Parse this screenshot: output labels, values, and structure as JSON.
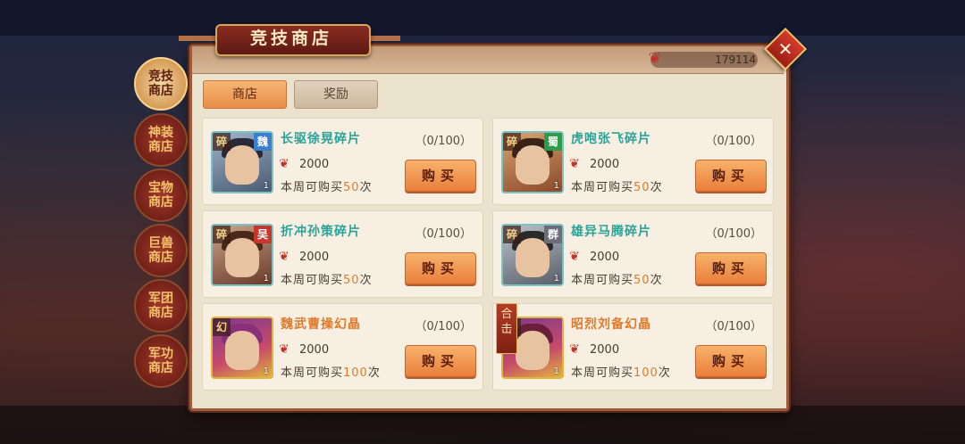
{
  "title": "竞技商店",
  "currency": {
    "icon": "coin-scroll-icon",
    "value": "179114"
  },
  "close_label": "✕",
  "tabs": [
    {
      "label": "商店",
      "active": true
    },
    {
      "label": "奖励",
      "active": false
    }
  ],
  "sidebar": [
    {
      "label": "竞技商店",
      "active": true
    },
    {
      "label": "神装商店",
      "active": false
    },
    {
      "label": "宝物商店",
      "active": false
    },
    {
      "label": "巨兽商店",
      "active": false
    },
    {
      "label": "军团商店",
      "active": false
    },
    {
      "label": "军功商店",
      "active": false
    }
  ],
  "items": [
    {
      "name": "长驱徐晃碎片",
      "limit": "（0/100）",
      "price": "2000",
      "weekly_prefix": "本周可购买",
      "weekly_num": "50",
      "weekly_suffix": "次",
      "buy_label": "购买",
      "tag": "碎",
      "faction": "魏",
      "count": "1",
      "kind": "fragment"
    },
    {
      "name": "虎咆张飞碎片",
      "limit": "（0/100）",
      "price": "2000",
      "weekly_prefix": "本周可购买",
      "weekly_num": "50",
      "weekly_suffix": "次",
      "buy_label": "购买",
      "tag": "碎",
      "faction": "蜀",
      "count": "1",
      "kind": "fragment"
    },
    {
      "name": "折冲孙策碎片",
      "limit": "（0/100）",
      "price": "2000",
      "weekly_prefix": "本周可购买",
      "weekly_num": "50",
      "weekly_suffix": "次",
      "buy_label": "购买",
      "tag": "碎",
      "faction": "吴",
      "count": "1",
      "kind": "fragment"
    },
    {
      "name": "雄异马腾碎片",
      "limit": "（0/100）",
      "price": "2000",
      "weekly_prefix": "本周可购买",
      "weekly_num": "50",
      "weekly_suffix": "次",
      "buy_label": "购买",
      "tag": "碎",
      "faction": "群",
      "count": "1",
      "kind": "fragment"
    },
    {
      "name": "魏武曹操幻晶",
      "limit": "（0/100）",
      "price": "2000",
      "weekly_prefix": "本周可购买",
      "weekly_num": "100",
      "weekly_suffix": "次",
      "buy_label": "购买",
      "tag": "幻",
      "faction": "",
      "count": "1",
      "kind": "crystal"
    },
    {
      "name": "昭烈刘备幻晶",
      "limit": "（0/100）",
      "price": "2000",
      "weekly_prefix": "本周可购买",
      "weekly_num": "100",
      "weekly_suffix": "次",
      "buy_label": "购买",
      "tag": "幻",
      "faction": "",
      "count": "1",
      "kind": "crystal",
      "badge": "合击"
    }
  ],
  "colors": {
    "faction_wei": "#3a7fd0",
    "faction_shu": "#2f9a4a",
    "faction_wu": "#c8352a",
    "faction_qun": "#6d6d7a",
    "accent": "#e07a2a",
    "teal": "#2aa39a"
  }
}
